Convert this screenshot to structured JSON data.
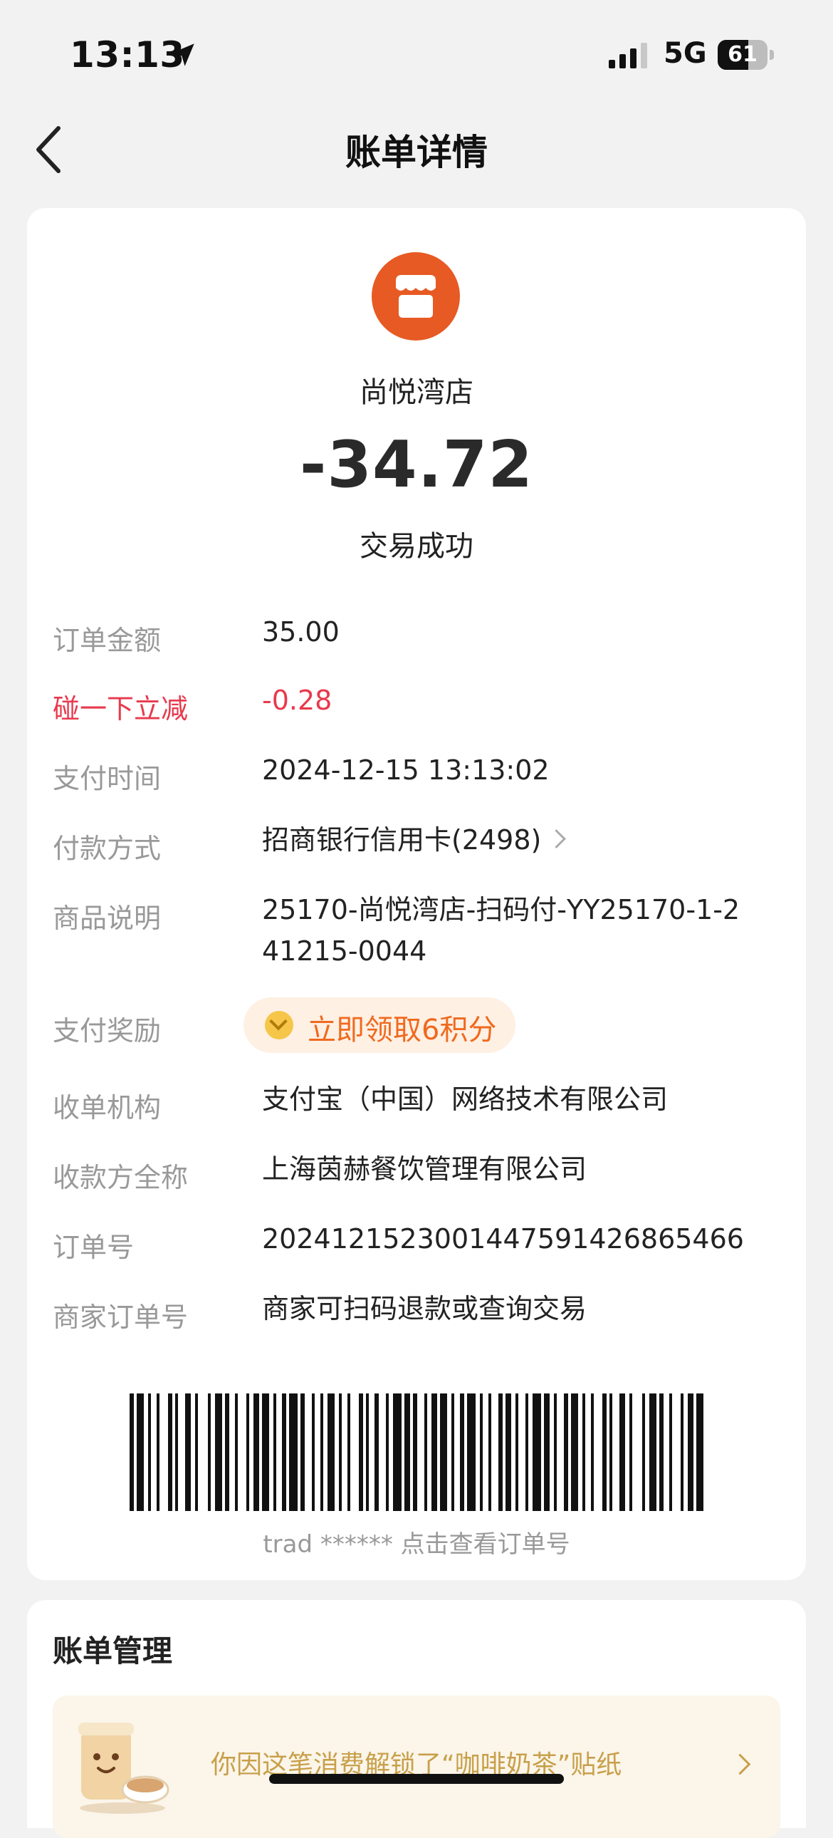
{
  "status_bar": {
    "time": "13:13",
    "network": "5G",
    "battery_level": "61"
  },
  "nav": {
    "title": "账单详情",
    "back_icon": "chevron-left-icon"
  },
  "merchant": {
    "name": "尚悦湾店",
    "icon": "store-icon",
    "icon_color": "#e75a24",
    "amount": "-34.72",
    "status": "交易成功"
  },
  "details": {
    "order_amount": {
      "label": "订单金额",
      "value": "35.00"
    },
    "discount": {
      "label": "碰一下立减",
      "value": "-0.28",
      "color": "#e8394c"
    },
    "pay_time": {
      "label": "支付时间",
      "value": "2024-12-15 13:13:02"
    },
    "pay_method": {
      "label": "付款方式",
      "value": "招商银行信用卡(2498)"
    },
    "product_desc": {
      "label": "商品说明",
      "line1": "25170-尚悦湾店-扫码付-YY25170-1-2",
      "line2": "41215-0044"
    },
    "reward": {
      "label": "支付奖励",
      "value": "立即领取6积分"
    },
    "acquirer": {
      "label": "收单机构",
      "value": "支付宝（中国）网络技术有限公司"
    },
    "payee": {
      "label": "收款方全称",
      "value": "上海茵赫餐饮管理有限公司"
    },
    "order_no": {
      "label": "订单号",
      "value": "2024121523001447591426865466"
    },
    "merchant_order_no": {
      "label": "商家订单号",
      "value": "商家可扫码退款或查询交易"
    }
  },
  "barcode": {
    "caption": "trad ****** 点击查看订单号"
  },
  "bill_management": {
    "heading": "账单管理",
    "sticker_text": "你因这笔消费解锁了“咖啡奶茶”贴纸",
    "sticker_icon": "coffee-cup-sticker-icon"
  }
}
